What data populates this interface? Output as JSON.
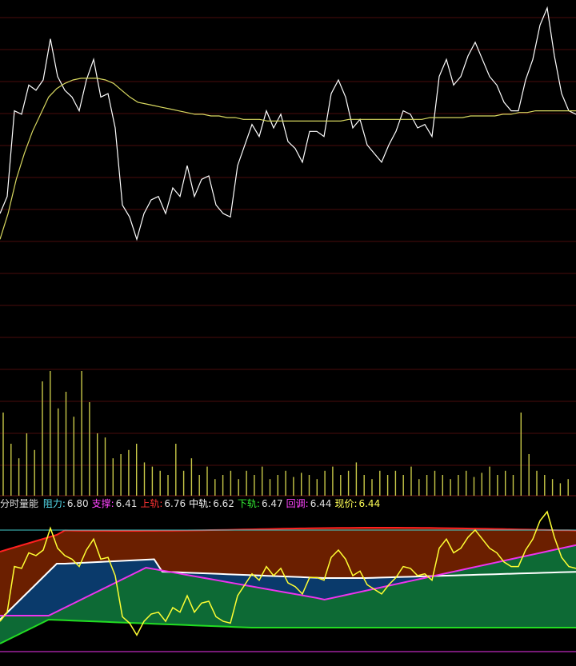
{
  "indicator": {
    "title": "分时量能",
    "items": [
      {
        "label": "阻力",
        "value": "6.80",
        "color": "#55ddee"
      },
      {
        "label": "支撑",
        "value": "6.41",
        "color": "#ff44ff"
      },
      {
        "label": "上轨",
        "value": "6.76",
        "color": "#ff3333"
      },
      {
        "label": "中轨",
        "value": "6.62",
        "color": "#ffffff"
      },
      {
        "label": "下轨",
        "value": "6.47",
        "color": "#33ee33"
      },
      {
        "label": "回调",
        "value": "6.44",
        "color": "#ff44ff"
      },
      {
        "label": "现价",
        "value": "6.44",
        "color": "#ffff55"
      }
    ]
  },
  "colors": {
    "background": "#000000",
    "grid": "#4a0d0d",
    "price_line": "#ffffff",
    "avg_line": "#d8d860",
    "volume": "#c8c848",
    "upper_fill": "#6b1f00",
    "mid_fill": "#0a3a6b",
    "lower_fill": "#0d6a35",
    "purple_fill": "#5a0a7a",
    "upper_line": "#ff2020",
    "mid_line": "#ffffff",
    "lower_line": "#22dd22",
    "support_line": "#ee33ee",
    "resist_line": "#44cccc",
    "current_line": "#ffff33"
  },
  "chart_data": {
    "type": "line",
    "title": "",
    "panels": [
      "price",
      "volume",
      "indicator"
    ],
    "price_series": [
      20,
      30,
      80,
      78,
      95,
      92,
      98,
      122,
      100,
      92,
      88,
      80,
      98,
      110,
      88,
      90,
      70,
      25,
      18,
      5,
      20,
      28,
      30,
      20,
      35,
      30,
      48,
      30,
      40,
      42,
      25,
      20,
      18,
      48,
      60,
      72,
      65,
      80,
      70,
      78,
      62,
      58,
      50,
      68,
      68,
      65,
      90,
      98,
      88,
      70,
      75,
      60,
      55,
      50,
      60,
      68,
      80,
      78,
      70,
      72,
      65,
      100,
      110,
      95,
      100,
      112,
      120,
      110,
      100,
      95,
      85,
      80,
      80,
      98,
      110,
      130,
      140,
      112,
      90,
      80,
      78
    ],
    "avg_series": [
      5,
      20,
      40,
      55,
      68,
      78,
      88,
      93,
      96,
      98,
      99,
      99,
      99,
      98,
      96,
      92,
      88,
      85,
      84,
      83,
      82,
      81,
      80,
      79,
      78,
      78,
      77,
      77,
      76,
      76,
      75,
      75,
      75,
      74,
      74,
      74,
      74,
      74,
      74,
      74,
      74,
      74,
      74,
      75,
      75,
      75,
      75,
      75,
      75,
      75,
      75,
      75,
      75,
      76,
      76,
      76,
      76,
      76,
      77,
      77,
      77,
      77,
      78,
      78,
      79,
      79,
      80,
      80,
      80,
      80,
      80,
      80
    ],
    "volume": [
      40,
      25,
      18,
      30,
      22,
      55,
      60,
      42,
      50,
      38,
      60,
      45,
      30,
      28,
      18,
      20,
      22,
      25,
      16,
      14,
      12,
      10,
      25,
      12,
      18,
      10,
      14,
      8,
      10,
      12,
      8,
      12,
      10,
      14,
      8,
      10,
      12,
      9,
      11,
      10,
      8,
      12,
      14,
      10,
      12,
      16,
      10,
      8,
      12,
      10,
      12,
      10,
      14,
      8,
      10,
      12,
      10,
      8,
      10,
      12,
      9,
      11,
      14,
      10,
      12,
      10,
      40,
      20,
      12,
      10,
      8,
      6,
      8
    ],
    "indicator_values": {
      "resistance": 6.8,
      "support": 6.41,
      "upper": 6.76,
      "middle": 6.62,
      "lower": 6.47,
      "pullback": 6.44,
      "current": 6.44
    }
  }
}
